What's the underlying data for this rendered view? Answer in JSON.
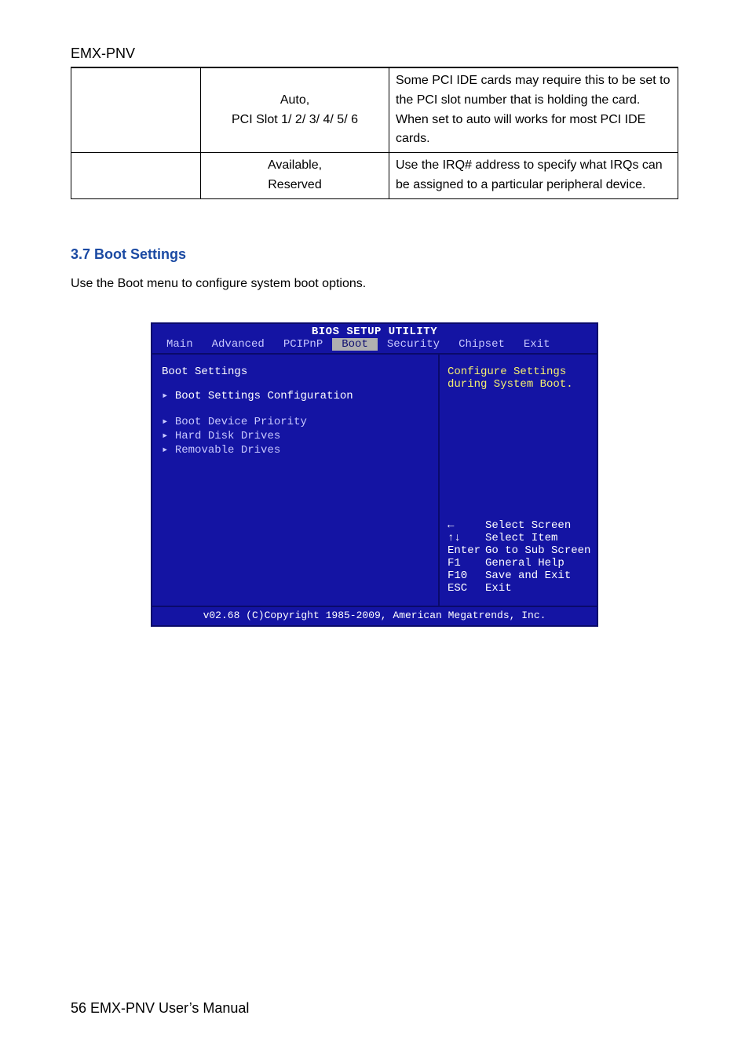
{
  "header": {
    "title": "EMX-PNV"
  },
  "table": {
    "rows": [
      {
        "c0": "",
        "c1": "Auto,\nPCI Slot 1/ 2/ 3/ 4/ 5/ 6",
        "c2": "Some PCI IDE cards may require this to be set to the PCI slot number that is holding the card. When set to auto will works for most PCI IDE cards."
      },
      {
        "c0": "",
        "c1": "Available,\nReserved",
        "c2": "Use the IRQ# address to specify what IRQs can be assigned to a particular peripheral device."
      }
    ]
  },
  "section": {
    "heading": "3.7 Boot Settings",
    "body": "Use the Boot menu to configure system boot options."
  },
  "bios": {
    "title": "BIOS SETUP UTILITY",
    "menu": [
      "Main",
      "Advanced",
      "PCIPnP",
      "Boot",
      "Security",
      "Chipset",
      "Exit"
    ],
    "active_menu": "Boot",
    "left_heading": "Boot Settings",
    "items": [
      {
        "label": "Boot Settings Configuration",
        "selected": true
      },
      {
        "label": "Boot Device Priority",
        "selected": false
      },
      {
        "label": "Hard Disk Drives",
        "selected": false
      },
      {
        "label": "Removable Drives",
        "selected": false
      }
    ],
    "help_top": [
      "Configure Settings",
      "during System Boot."
    ],
    "help_keys": [
      {
        "key": "←",
        "desc": "Select Screen"
      },
      {
        "key": "↑↓",
        "desc": "Select Item"
      },
      {
        "key": "Enter",
        "desc": "Go to Sub Screen"
      },
      {
        "key": "F1",
        "desc": "General Help"
      },
      {
        "key": "F10",
        "desc": "Save and Exit"
      },
      {
        "key": "ESC",
        "desc": "Exit"
      }
    ],
    "footer": "v02.68 (C)Copyright 1985-2009, American Megatrends, Inc."
  },
  "footer": {
    "text": "56 EMX-PNV User’s Manual"
  }
}
